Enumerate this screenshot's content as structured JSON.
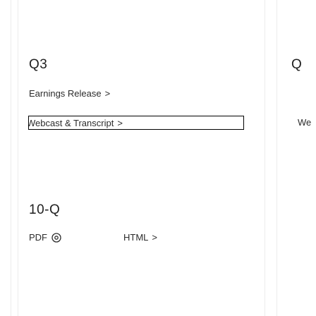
{
  "sections": [
    {
      "title": "Q3",
      "links": [
        {
          "label": "Earnings Release",
          "chevron": ">"
        },
        {
          "label": "Webcast & Transcript",
          "chevron": ">"
        }
      ]
    },
    {
      "title": "10-Q",
      "links": [
        {
          "label": "PDF",
          "icon": "download-icon"
        },
        {
          "label": "HTML",
          "chevron": ">"
        }
      ]
    }
  ],
  "next_card": {
    "title_partial": "Q",
    "link_partial": "We"
  },
  "colors": {
    "text": "#1f1f1f",
    "focus_outline": "#000000",
    "card_border": "#ececec"
  }
}
